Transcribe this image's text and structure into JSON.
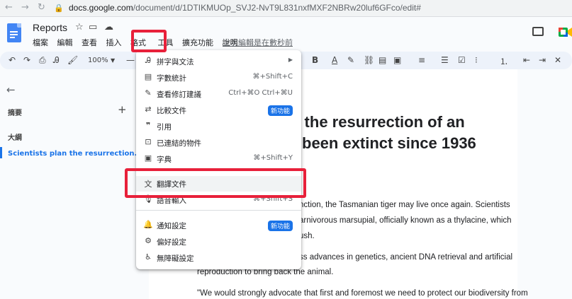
{
  "browser": {
    "host": "docs.google.com",
    "path": "/document/d/1DTIKMUOp_SVJ2-NvT9L831nxfMXF2NBRw20luf6GFco/edit#"
  },
  "doc": {
    "title": "Reports",
    "last_edit": "上次編輯是在數秒前"
  },
  "menubar": [
    "檔案",
    "編輯",
    "查看",
    "插入",
    "格式",
    "工具",
    "擴充功能",
    "說明"
  ],
  "toolbar": {
    "zoom": "100%"
  },
  "sidebar": {
    "summary_label": "摘要",
    "outline_label": "大綱",
    "outline_item": "Scientists plan the resurrection..."
  },
  "page": {
    "heading_line1": "n the resurrection of an",
    "heading_line2": "been extinct since 1936",
    "p1_line1": "nction, the Tasmanian tiger may live once again. Scientists",
    "p1_line2": "arnivorous marsupial, officially known as a thylacine, which",
    "p1_line3": "ush.",
    "p2_line1": "ss advances in genetics, ancient DNA retrieval and artificial",
    "p2_line2": "reproduction to bring back the animal.",
    "p3_line1": "\"We would strongly advocate that first and foremost we need to protect our biodiversity from"
  },
  "tools_menu": {
    "items": [
      {
        "label": "拼字與文法",
        "icon": "spellcheck-icon",
        "has_submenu": true
      },
      {
        "label": "字數統計",
        "icon": "word-count-icon",
        "shortcut": "⌘+Shift+C"
      },
      {
        "label": "查看修訂建議",
        "icon": "review-edits-icon",
        "shortcut": "Ctrl+⌘O Ctrl+⌘U"
      },
      {
        "label": "比較文件",
        "icon": "compare-icon",
        "badge": "新功能"
      },
      {
        "label": "引用",
        "icon": "quote-icon"
      },
      {
        "label": "已連結的物件",
        "icon": "linked-objects-icon"
      },
      {
        "label": "字典",
        "icon": "dictionary-icon",
        "shortcut": "⌘+Shift+Y"
      },
      {
        "label": "翻譯文件",
        "icon": "translate-icon"
      },
      {
        "label": "語音輸入",
        "icon": "microphone-icon",
        "shortcut": "⌘+Shift+S"
      },
      {
        "label": "通知設定",
        "icon": "bell-icon",
        "badge": "新功能"
      },
      {
        "label": "偏好設定",
        "icon": "preferences-icon"
      },
      {
        "label": "無障礙設定",
        "icon": "accessibility-icon"
      }
    ]
  },
  "colors": {
    "highlight": "#e8203a",
    "accent": "#1a73e8",
    "toolbar_bg": "#edf2fa"
  }
}
